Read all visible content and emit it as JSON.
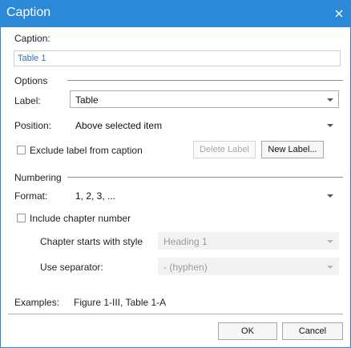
{
  "window": {
    "title": "Caption"
  },
  "caption": {
    "label": "Caption:",
    "value": "Table 1"
  },
  "options": {
    "group_label": "Options",
    "label_label": "Label:",
    "label_value": "Table",
    "position_label": "Position:",
    "position_value": "Above selected item",
    "exclude_label": "Exclude label from caption",
    "delete_label_button": "Delete Label",
    "new_label_button": "New Label..."
  },
  "numbering": {
    "group_label": "Numbering",
    "format_label": "Format:",
    "format_value": "1, 2, 3, ...",
    "include_chapter_label": "Include chapter number",
    "chapter_style_label": "Chapter starts with style",
    "chapter_style_value": "Heading 1",
    "separator_label": "Use separator:",
    "separator_value": "- (hyphen)"
  },
  "examples": {
    "label": "Examples:",
    "value": "Figure 1-III, Table 1-A"
  },
  "footer": {
    "ok_label": "OK",
    "cancel_label": "Cancel"
  },
  "colors": {
    "titlebar": "#2b89d8",
    "input_text": "#3a6fb0"
  }
}
